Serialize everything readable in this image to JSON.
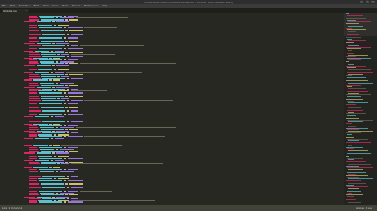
{
  "window": {
    "title": "C:\\Users\\user\\Desktop\\Globals\\Globals.lua - Sublime Text (UNREGISTERED)",
    "controls": [
      "—",
      "□",
      "✕"
    ]
  },
  "menu": [
    "File",
    "Edit",
    "Selection",
    "Find",
    "View",
    "Goto",
    "Tools",
    "Project",
    "Preferences",
    "Help"
  ],
  "tab": {
    "label": "Globals.lua",
    "close": "×"
  },
  "colors": {
    "keyword": "#f92672",
    "field": "#66d9ef",
    "string": "#e6db74",
    "comment": "#75715e",
    "plain": "#cfcfc2",
    "bool": "#ae81ff"
  },
  "status": {
    "left": "Line 1, Column 1",
    "right": "Spaces: 4    Lua"
  }
}
